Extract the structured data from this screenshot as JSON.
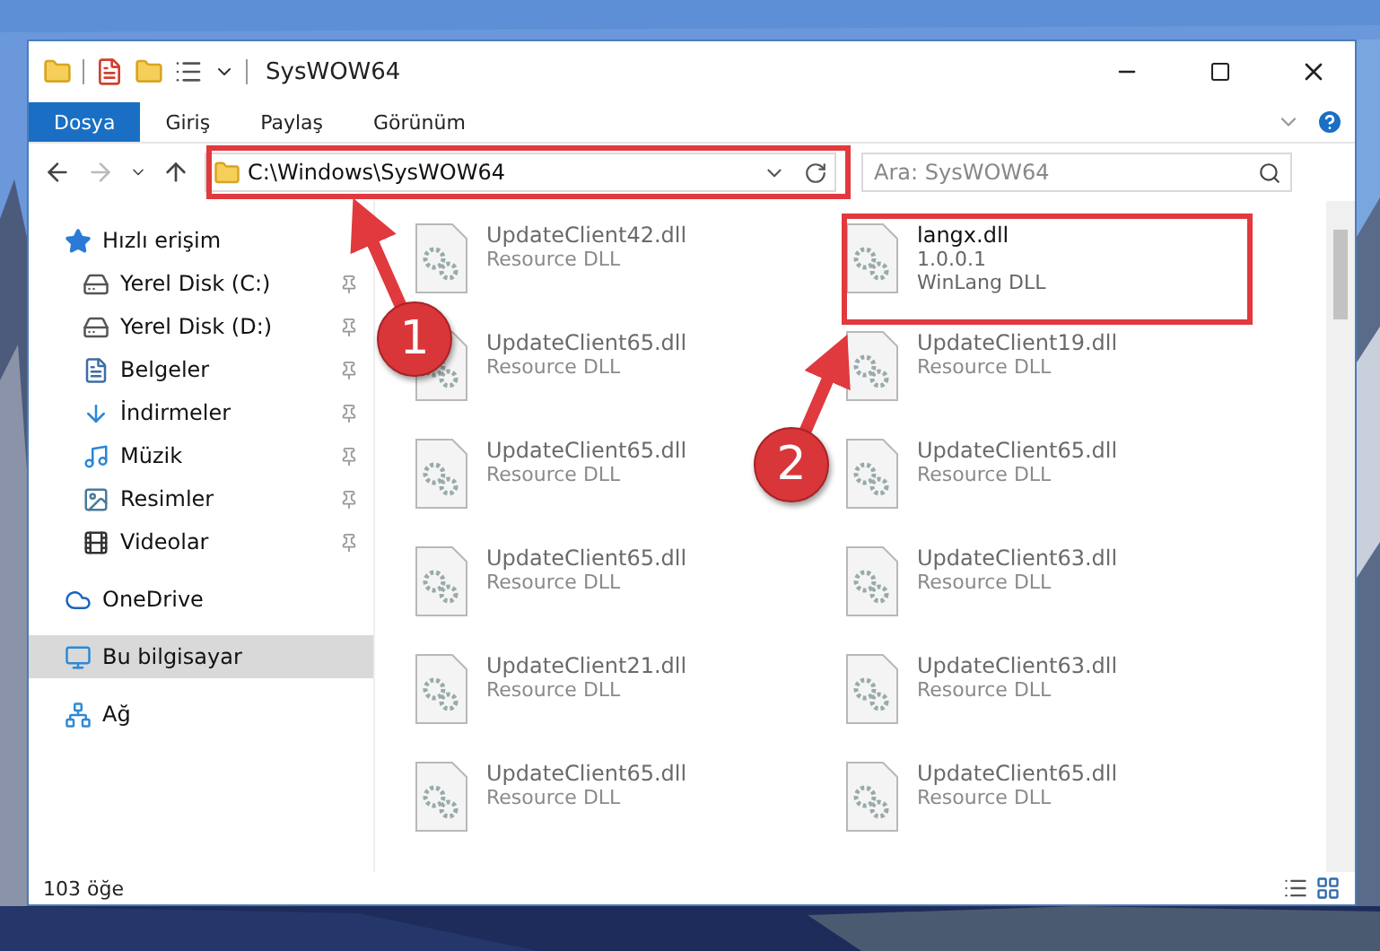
{
  "window": {
    "title": "SysWOW64"
  },
  "ribbon_tabs": [
    {
      "label": "Dosya",
      "selected": true
    },
    {
      "label": "Giriş",
      "selected": false
    },
    {
      "label": "Paylaş",
      "selected": false
    },
    {
      "label": "Görünüm",
      "selected": false
    }
  ],
  "address": {
    "path": "C:\\Windows\\SysWOW64"
  },
  "search": {
    "placeholder": "Ara: SysWOW64"
  },
  "sidebar": {
    "items": [
      {
        "label": "Hızlı erişim",
        "kind": "star",
        "selected": false,
        "children": [
          {
            "label": "Yerel Disk (C:)",
            "kind": "systemdrive",
            "pinned": true
          },
          {
            "label": "Yerel Disk (D:)",
            "kind": "drive",
            "pinned": true
          },
          {
            "label": "Belgeler",
            "kind": "documents",
            "pinned": true
          },
          {
            "label": "İndirmeler",
            "kind": "downloads",
            "pinned": true
          },
          {
            "label": "Müzik",
            "kind": "music",
            "pinned": true
          },
          {
            "label": "Resimler",
            "kind": "pictures",
            "pinned": true
          },
          {
            "label": "Videolar",
            "kind": "videos",
            "pinned": true
          }
        ]
      },
      {
        "label": "OneDrive",
        "kind": "cloud",
        "selected": false
      },
      {
        "label": "Bu bilgisayar",
        "kind": "computer",
        "selected": true
      },
      {
        "label": "Ağ",
        "kind": "network",
        "selected": false
      }
    ]
  },
  "files": [
    {
      "name": "UpdateClient42.dll",
      "lines": [
        "Resource DLL"
      ],
      "blurred": true
    },
    {
      "name": "langx.dll",
      "lines": [
        "1.0.0.1",
        "WinLang DLL"
      ],
      "blurred": false
    },
    {
      "name": "UpdateClient65.dll",
      "lines": [
        "Resource DLL"
      ],
      "blurred": true
    },
    {
      "name": "UpdateClient19.dll",
      "lines": [
        "Resource DLL"
      ],
      "blurred": true
    },
    {
      "name": "UpdateClient65.dll",
      "lines": [
        "Resource DLL"
      ],
      "blurred": true
    },
    {
      "name": "UpdateClient65.dll",
      "lines": [
        "Resource DLL"
      ],
      "blurred": true
    },
    {
      "name": "UpdateClient65.dll",
      "lines": [
        "Resource DLL"
      ],
      "blurred": true
    },
    {
      "name": "UpdateClient63.dll",
      "lines": [
        "Resource DLL"
      ],
      "blurred": true
    },
    {
      "name": "UpdateClient21.dll",
      "lines": [
        "Resource DLL"
      ],
      "blurred": true
    },
    {
      "name": "UpdateClient63.dll",
      "lines": [
        "Resource DLL"
      ],
      "blurred": true
    },
    {
      "name": "UpdateClient65.dll",
      "lines": [
        "Resource DLL"
      ],
      "blurred": true
    },
    {
      "name": "UpdateClient65.dll",
      "lines": [
        "Resource DLL"
      ],
      "blurred": true
    }
  ],
  "status_bar": {
    "count": "103 öğe"
  },
  "annotations": [
    {
      "number": "1"
    },
    {
      "number": "2"
    }
  ]
}
